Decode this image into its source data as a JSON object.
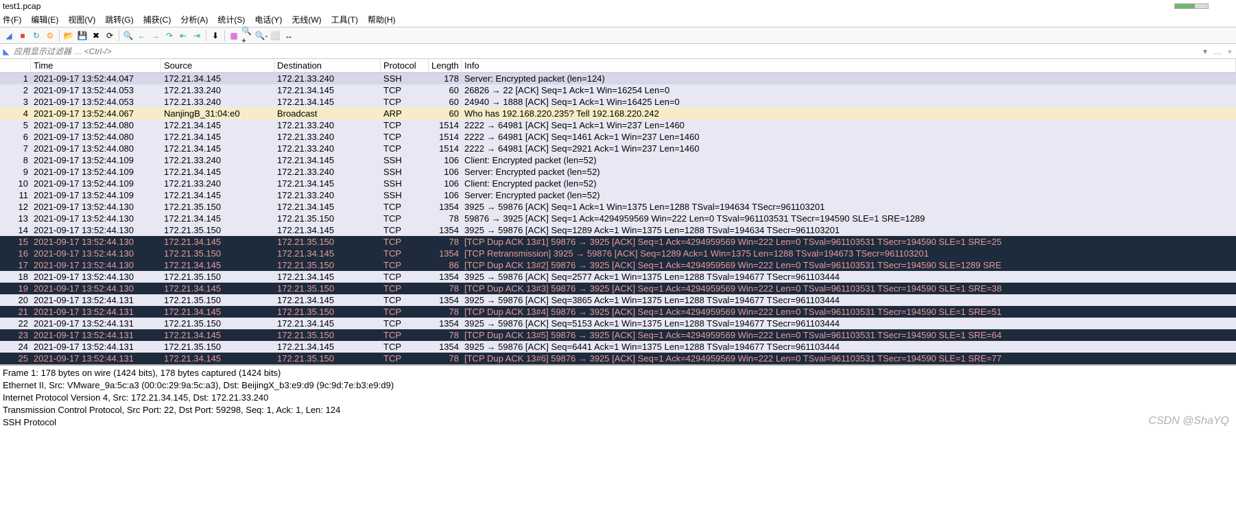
{
  "title": "test1.pcap",
  "menu": {
    "file": "件(F)",
    "edit": "编辑(E)",
    "view": "视图(V)",
    "go": "跳转(G)",
    "capture": "捕获(C)",
    "analyze": "分析(A)",
    "statistics": "统计(S)",
    "telephony": "电话(Y)",
    "wireless": "无线(W)",
    "tools": "工具(T)",
    "help": "帮助(H)"
  },
  "filter_placeholder": "应用显示过滤器 … <Ctrl-/>",
  "columns": {
    "no": "",
    "time": "Time",
    "src": "Source",
    "dst": "Destination",
    "proto": "Protocol",
    "len": "Length",
    "info": "Info"
  },
  "packets": [
    {
      "no": "1",
      "time": "2021-09-17 13:52:44.047",
      "src": "172.21.34.145",
      "dst": "172.21.33.240",
      "proto": "SSH",
      "len": "178",
      "info": "Server: Encrypted packet (len=124)",
      "cls": "selected"
    },
    {
      "no": "2",
      "time": "2021-09-17 13:52:44.053",
      "src": "172.21.33.240",
      "dst": "172.21.34.145",
      "proto": "TCP",
      "len": "60",
      "info": "26826 → 22 [ACK] Seq=1 Ack=1 Win=16254 Len=0",
      "cls": "normal-tcp"
    },
    {
      "no": "3",
      "time": "2021-09-17 13:52:44.053",
      "src": "172.21.33.240",
      "dst": "172.21.34.145",
      "proto": "TCP",
      "len": "60",
      "info": "24940 → 1888 [ACK] Seq=1 Ack=1 Win=16425 Len=0",
      "cls": "normal-tcp"
    },
    {
      "no": "4",
      "time": "2021-09-17 13:52:44.067",
      "src": "NanjingB_31:04:e0",
      "dst": "Broadcast",
      "proto": "ARP",
      "len": "60",
      "info": "Who has 192.168.220.235? Tell 192.168.220.242",
      "cls": "arp-row"
    },
    {
      "no": "5",
      "time": "2021-09-17 13:52:44.080",
      "src": "172.21.34.145",
      "dst": "172.21.33.240",
      "proto": "TCP",
      "len": "1514",
      "info": "2222 → 64981 [ACK] Seq=1 Ack=1 Win=237 Len=1460",
      "cls": "normal-tcp"
    },
    {
      "no": "6",
      "time": "2021-09-17 13:52:44.080",
      "src": "172.21.34.145",
      "dst": "172.21.33.240",
      "proto": "TCP",
      "len": "1514",
      "info": "2222 → 64981 [ACK] Seq=1461 Ack=1 Win=237 Len=1460",
      "cls": "normal-tcp"
    },
    {
      "no": "7",
      "time": "2021-09-17 13:52:44.080",
      "src": "172.21.34.145",
      "dst": "172.21.33.240",
      "proto": "TCP",
      "len": "1514",
      "info": "2222 → 64981 [ACK] Seq=2921 Ack=1 Win=237 Len=1460",
      "cls": "normal-tcp"
    },
    {
      "no": "8",
      "time": "2021-09-17 13:52:44.109",
      "src": "172.21.33.240",
      "dst": "172.21.34.145",
      "proto": "SSH",
      "len": "106",
      "info": "Client: Encrypted packet (len=52)",
      "cls": "normal-ssh"
    },
    {
      "no": "9",
      "time": "2021-09-17 13:52:44.109",
      "src": "172.21.34.145",
      "dst": "172.21.33.240",
      "proto": "SSH",
      "len": "106",
      "info": "Server: Encrypted packet (len=52)",
      "cls": "normal-ssh"
    },
    {
      "no": "10",
      "time": "2021-09-17 13:52:44.109",
      "src": "172.21.33.240",
      "dst": "172.21.34.145",
      "proto": "SSH",
      "len": "106",
      "info": "Client: Encrypted packet (len=52)",
      "cls": "normal-ssh"
    },
    {
      "no": "11",
      "time": "2021-09-17 13:52:44.109",
      "src": "172.21.34.145",
      "dst": "172.21.33.240",
      "proto": "SSH",
      "len": "106",
      "info": "Server: Encrypted packet (len=52)",
      "cls": "normal-ssh"
    },
    {
      "no": "12",
      "time": "2021-09-17 13:52:44.130",
      "src": "172.21.35.150",
      "dst": "172.21.34.145",
      "proto": "TCP",
      "len": "1354",
      "info": "3925 → 59876 [ACK] Seq=1 Ack=1 Win=1375 Len=1288 TSval=194634 TSecr=961103201",
      "cls": "normal-tcp"
    },
    {
      "no": "13",
      "time": "2021-09-17 13:52:44.130",
      "src": "172.21.34.145",
      "dst": "172.21.35.150",
      "proto": "TCP",
      "len": "78",
      "info": "59876 → 3925 [ACK] Seq=1 Ack=4294959569 Win=222 Len=0 TSval=961103531 TSecr=194590 SLE=1 SRE=1289",
      "cls": "normal-tcp"
    },
    {
      "no": "14",
      "time": "2021-09-17 13:52:44.130",
      "src": "172.21.35.150",
      "dst": "172.21.34.145",
      "proto": "TCP",
      "len": "1354",
      "info": "3925 → 59876 [ACK] Seq=1289 Ack=1 Win=1375 Len=1288 TSval=194634 TSecr=961103201",
      "cls": "normal-tcp"
    },
    {
      "no": "15",
      "time": "2021-09-17 13:52:44.130",
      "src": "172.21.34.145",
      "dst": "172.21.35.150",
      "proto": "TCP",
      "len": "78",
      "info": "[TCP Dup ACK 13#1] 59876 → 3925 [ACK] Seq=1 Ack=4294959569 Win=222 Len=0 TSval=961103531 TSecr=194590 SLE=1 SRE=25",
      "cls": "dark-row"
    },
    {
      "no": "16",
      "time": "2021-09-17 13:52:44.130",
      "src": "172.21.35.150",
      "dst": "172.21.34.145",
      "proto": "TCP",
      "len": "1354",
      "info": "[TCP Retransmission] 3925 → 59876 [ACK] Seq=1289 Ack=1 Win=1375 Len=1288 TSval=194673 TSecr=961103201",
      "cls": "dark-row"
    },
    {
      "no": "17",
      "time": "2021-09-17 13:52:44.130",
      "src": "172.21.34.145",
      "dst": "172.21.35.150",
      "proto": "TCP",
      "len": "86",
      "info": "[TCP Dup ACK 13#2] 59876 → 3925 [ACK] Seq=1 Ack=4294959569 Win=222 Len=0 TSval=961103531 TSecr=194590 SLE=1289 SRE",
      "cls": "dark-row"
    },
    {
      "no": "18",
      "time": "2021-09-17 13:52:44.130",
      "src": "172.21.35.150",
      "dst": "172.21.34.145",
      "proto": "TCP",
      "len": "1354",
      "info": "3925 → 59876 [ACK] Seq=2577 Ack=1 Win=1375 Len=1288 TSval=194677 TSecr=961103444",
      "cls": "normal-tcp"
    },
    {
      "no": "19",
      "time": "2021-09-17 13:52:44.130",
      "src": "172.21.34.145",
      "dst": "172.21.35.150",
      "proto": "TCP",
      "len": "78",
      "info": "[TCP Dup ACK 13#3] 59876 → 3925 [ACK] Seq=1 Ack=4294959569 Win=222 Len=0 TSval=961103531 TSecr=194590 SLE=1 SRE=38",
      "cls": "dark-row"
    },
    {
      "no": "20",
      "time": "2021-09-17 13:52:44.131",
      "src": "172.21.35.150",
      "dst": "172.21.34.145",
      "proto": "TCP",
      "len": "1354",
      "info": "3925 → 59876 [ACK] Seq=3865 Ack=1 Win=1375 Len=1288 TSval=194677 TSecr=961103444",
      "cls": "normal-tcp"
    },
    {
      "no": "21",
      "time": "2021-09-17 13:52:44.131",
      "src": "172.21.34.145",
      "dst": "172.21.35.150",
      "proto": "TCP",
      "len": "78",
      "info": "[TCP Dup ACK 13#4] 59876 → 3925 [ACK] Seq=1 Ack=4294959569 Win=222 Len=0 TSval=961103531 TSecr=194590 SLE=1 SRE=51",
      "cls": "dark-row"
    },
    {
      "no": "22",
      "time": "2021-09-17 13:52:44.131",
      "src": "172.21.35.150",
      "dst": "172.21.34.145",
      "proto": "TCP",
      "len": "1354",
      "info": "3925 → 59876 [ACK] Seq=5153 Ack=1 Win=1375 Len=1288 TSval=194677 TSecr=961103444",
      "cls": "normal-tcp"
    },
    {
      "no": "23",
      "time": "2021-09-17 13:52:44.131",
      "src": "172.21.34.145",
      "dst": "172.21.35.150",
      "proto": "TCP",
      "len": "78",
      "info": "[TCP Dup ACK 13#5] 59876 → 3925 [ACK] Seq=1 Ack=4294959569 Win=222 Len=0 TSval=961103531 TSecr=194590 SLE=1 SRE=64",
      "cls": "dark-row"
    },
    {
      "no": "24",
      "time": "2021-09-17 13:52:44.131",
      "src": "172.21.35.150",
      "dst": "172.21.34.145",
      "proto": "TCP",
      "len": "1354",
      "info": "3925 → 59876 [ACK] Seq=6441 Ack=1 Win=1375 Len=1288 TSval=194677 TSecr=961103444",
      "cls": "normal-tcp"
    },
    {
      "no": "25",
      "time": "2021-09-17 13:52:44.131",
      "src": "172.21.34.145",
      "dst": "172.21.35.150",
      "proto": "TCP",
      "len": "78",
      "info": "[TCP Dup ACK 13#6] 59876 → 3925 [ACK] Seq=1 Ack=4294959569 Win=222 Len=0 TSval=961103531 TSecr=194590 SLE=1 SRE=77",
      "cls": "dark-row"
    }
  ],
  "details": {
    "l1": "Frame 1: 178 bytes on wire (1424 bits), 178 bytes captured (1424 bits)",
    "l2": "Ethernet II, Src: VMware_9a:5c:a3 (00:0c:29:9a:5c:a3), Dst: BeijingX_b3:e9:d9 (9c:9d:7e:b3:e9:d9)",
    "l3": "Internet Protocol Version 4, Src: 172.21.34.145, Dst: 172.21.33.240",
    "l4": "Transmission Control Protocol, Src Port: 22, Dst Port: 59298, Seq: 1, Ack: 1, Len: 124",
    "l5": "SSH Protocol"
  },
  "watermark": "CSDN @ShaYQ"
}
